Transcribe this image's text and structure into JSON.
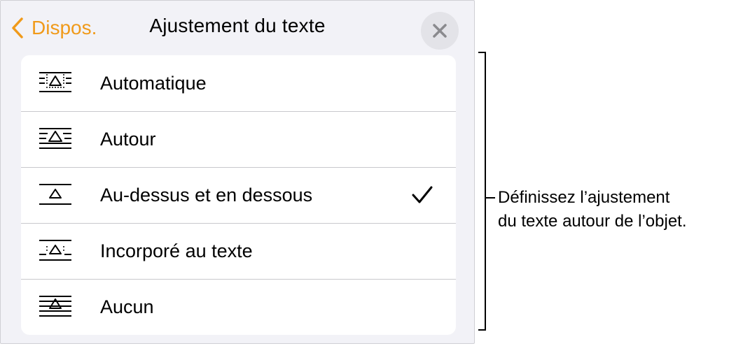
{
  "header": {
    "back_label": "Dispos.",
    "title": "Ajustement du texte",
    "close_icon": "close-icon"
  },
  "accent_color": "#f09a1a",
  "options": [
    {
      "label": "Automatique",
      "icon": "wrap-automatic-icon",
      "selected": false
    },
    {
      "label": "Autour",
      "icon": "wrap-around-icon",
      "selected": false
    },
    {
      "label": "Au-dessus et en dessous",
      "icon": "wrap-above-below-icon",
      "selected": true
    },
    {
      "label": "Incorporé au texte",
      "icon": "wrap-inline-icon",
      "selected": false
    },
    {
      "label": "Aucun",
      "icon": "wrap-none-icon",
      "selected": false
    }
  ],
  "callout": {
    "line1": "Définissez l’ajustement",
    "line2": "du texte autour de l’objet."
  }
}
